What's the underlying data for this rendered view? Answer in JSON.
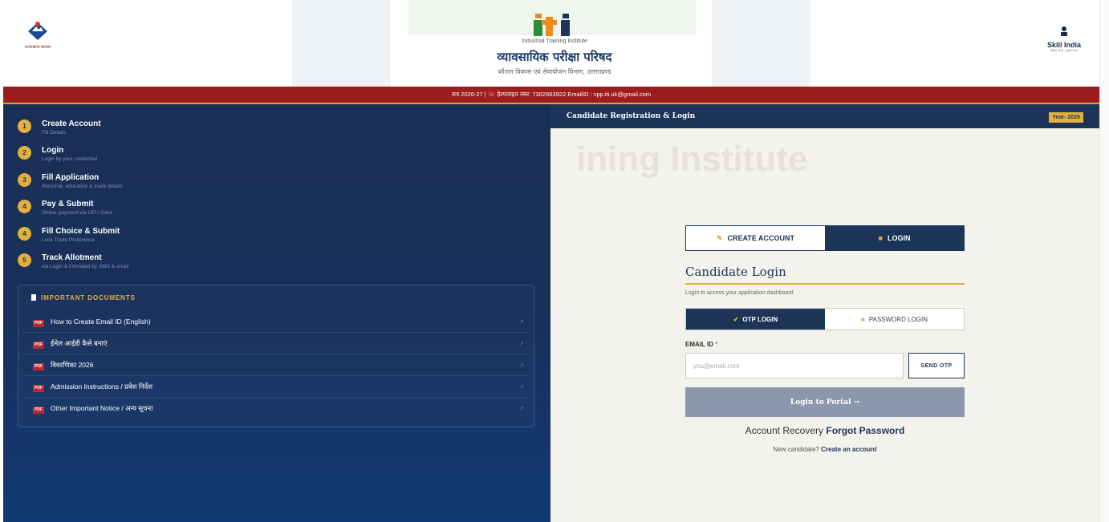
{
  "header": {
    "left_logo_caption": "उत्तराखण्ड सरकार",
    "iti_logo_text": "iti",
    "iti_subtitle": "Industrial Training Institute",
    "title_hindi": "व्यावसायिक परीक्षा परिषद",
    "department": "कौशल विकास एवं सेवायोजन विभाग, उत्तराखण्ड",
    "skill_india": "Skill India",
    "skill_india_tagline": "कौशल भारत - कुशल भारत"
  },
  "infobar": {
    "session": "सत्र 2026-27  |",
    "helpline": "हेल्पलाइन नंबर: 7302663922",
    "email": "EmailID : vpp.iti.uk@gmail.com"
  },
  "steps": [
    {
      "num": "1",
      "title": "Create Account",
      "desc": "Fill Details"
    },
    {
      "num": "2",
      "title": "Login",
      "desc": "Login by your credential"
    },
    {
      "num": "3",
      "title": "Fill Application",
      "desc": "Personal, education & trade details"
    },
    {
      "num": "4",
      "title": "Pay & Submit",
      "desc": "Online payment via UPI / Card"
    },
    {
      "num": "4",
      "title": "Fill Choice & Submit",
      "desc": "Lock Trade Preference"
    },
    {
      "num": "5",
      "title": "Track Allotment",
      "desc": "via Login & intimated by SMS & email"
    }
  ],
  "documents": {
    "heading": "IMPORTANT DOCUMENTS",
    "badge": "PDF",
    "items": [
      {
        "label": "How to Create Email ID (English)"
      },
      {
        "label": "ईमेल आईडी कैसे बनाएं"
      },
      {
        "label": "विवरणिका 2026"
      },
      {
        "label": "Admission Instructions / प्रवेश निर्देश"
      },
      {
        "label": "Other Important Notice / अन्य सूचना"
      }
    ]
  },
  "right": {
    "header_title": "Candidate Registration & Login",
    "year_badge": "Year- 2026",
    "watermark": "ining Institute",
    "tabs": {
      "create": "CREATE ACCOUNT",
      "login": "LOGIN"
    },
    "login_title": "Candidate Login",
    "login_subtitle": "Login to access your application dashboard",
    "method_tabs": {
      "otp": "OTP LOGIN",
      "password": "PASSWORD LOGIN"
    },
    "email_label": "EMAIL ID",
    "email_required": "*",
    "email_placeholder": "you@email.com",
    "email_value": "",
    "send_otp": "SEND OTP",
    "login_button": "Login to Portal →",
    "recovery_prefix": "Account Recovery",
    "recovery_link": "Forgot Password",
    "new_candidate_prefix": "New candidate?",
    "new_candidate_link": "Create an account"
  },
  "colors": {
    "navy": "#1b3458",
    "gold": "#e2b03e",
    "maroon": "#9b1d1d",
    "pdf_red": "#c0262d",
    "disabled_button": "#8a97ad"
  }
}
